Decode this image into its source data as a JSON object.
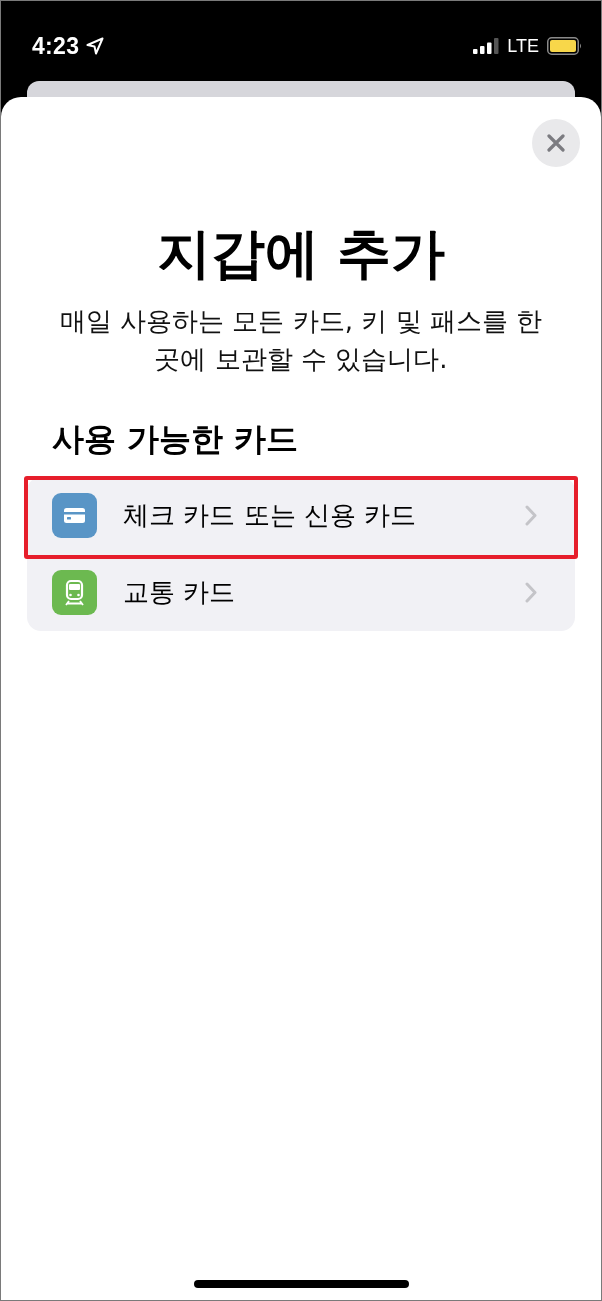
{
  "status_bar": {
    "time": "4:23",
    "network": "LTE"
  },
  "sheet": {
    "title": "지갑에 추가",
    "subtitle": "매일 사용하는 모든 카드, 키 및 패스를 한 곳에 보관할 수 있습니다.",
    "section_heading": "사용 가능한 카드",
    "options": [
      {
        "label": "체크 카드 또는 신용 카드",
        "kind": "card",
        "highlighted": true
      },
      {
        "label": "교통 카드",
        "kind": "transit",
        "highlighted": false
      }
    ]
  }
}
